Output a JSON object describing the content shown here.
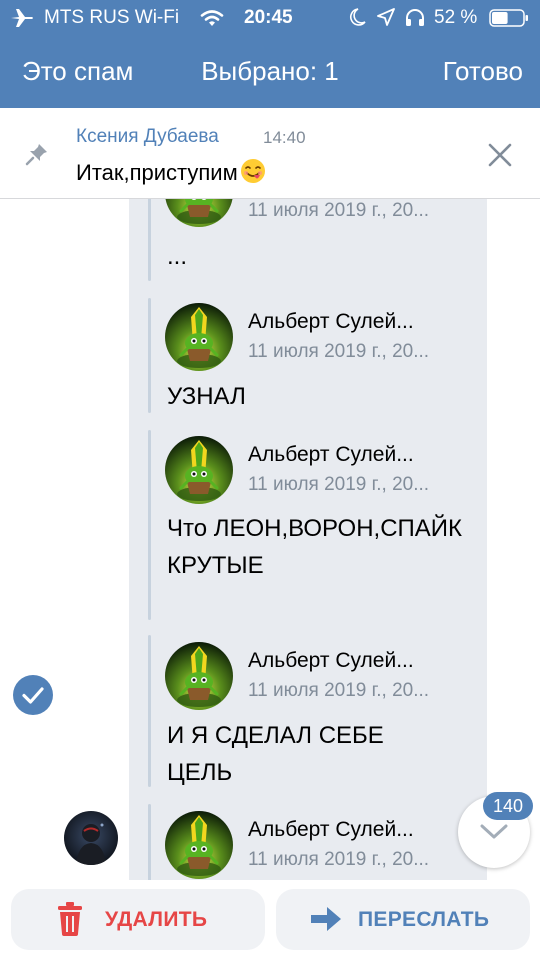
{
  "status_bar": {
    "carrier": "MTS RUS Wi-Fi",
    "time": "20:45",
    "battery_percent": "52 %",
    "battery_level": 0.52,
    "icons": [
      "airplane-icon",
      "wifi-icon",
      "moon-icon",
      "location-icon",
      "headphones-icon",
      "battery-icon"
    ]
  },
  "nav": {
    "left_action": "Это спам",
    "title": "Выбрано: 1",
    "right_action": "Готово"
  },
  "pinned": {
    "author": "Ксения Дубаева",
    "time": "14:40",
    "text": "Итак,приступим",
    "icons": [
      "pin-icon",
      "close-icon",
      "emoji-icon"
    ]
  },
  "forwarded": [
    {
      "name": "",
      "date": "11 июля 2019 г., 20...",
      "text": "..."
    },
    {
      "name": "Альберт Сулей...",
      "date": "11 июля 2019 г., 20...",
      "text": "УЗНАЛ"
    },
    {
      "name": "Альберт Сулей...",
      "date": "11 июля 2019 г., 20...",
      "text": "Что ЛЕОН,ВОРОН,СПАЙК КРУТЫЕ"
    },
    {
      "name": "Альберт Сулей...",
      "date": "11 июля 2019 г., 20...",
      "text": "И Я СДЕЛАЛ СЕБЕ ЦЕЛЬ"
    },
    {
      "name": "Альберт Сулей...",
      "date": "11 июля 2019 г., 20...",
      "text": ""
    }
  ],
  "unread_count": "140",
  "bottom": {
    "delete_label": "УДАЛИТЬ",
    "forward_label": "ПЕРЕСЛАТЬ"
  },
  "colors": {
    "header": "#5181b8",
    "accent": "#5181b8",
    "danger": "#e64646",
    "selected_bg": "#e8ebf0",
    "secondary_text": "#818c99"
  }
}
